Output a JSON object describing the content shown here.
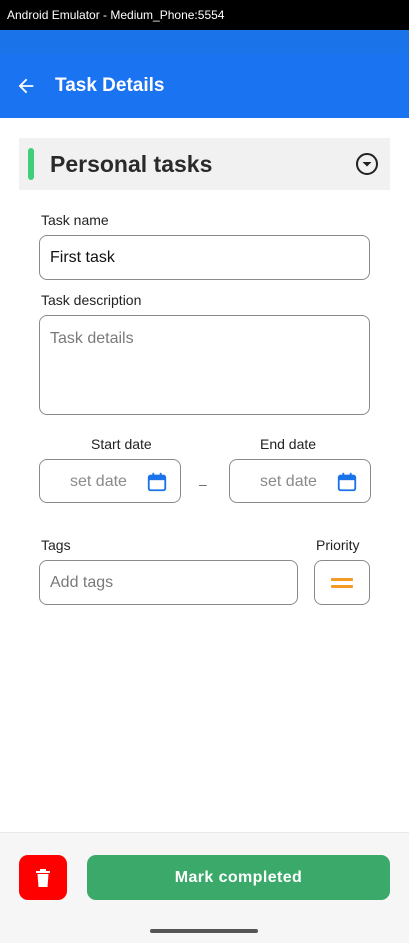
{
  "window": {
    "title": "Android Emulator - Medium_Phone:5554"
  },
  "app_bar": {
    "title": "Task Details",
    "back_icon": "arrow-left-icon"
  },
  "list": {
    "name": "Personal tasks",
    "accent_color": "#3ecf78"
  },
  "form": {
    "task_name_label": "Task name",
    "task_name_value": "First task",
    "task_description_label": "Task description",
    "task_description_placeholder": "Task details",
    "start_date_label": "Start date",
    "end_date_label": "End date",
    "date_placeholder": "set date",
    "date_separator": "–",
    "tags_label": "Tags",
    "tags_placeholder": "Add tags",
    "priority_label": "Priority",
    "priority_color": "#f59a23"
  },
  "actions": {
    "mark_completed": "Mark completed",
    "delete_icon": "trash-icon"
  },
  "colors": {
    "primary": "#1a73f0",
    "success": "#3aa96a",
    "danger": "#ff0000"
  }
}
